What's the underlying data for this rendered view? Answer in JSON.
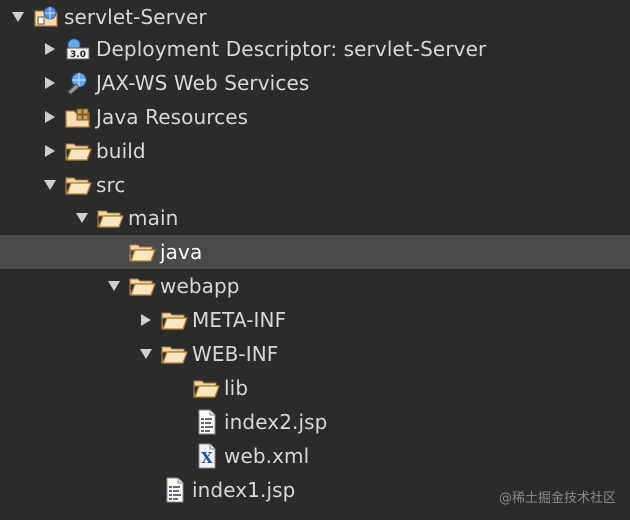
{
  "tree": {
    "project": {
      "label": "servlet-Server"
    },
    "deployment_descriptor": {
      "label": "Deployment Descriptor: servlet-Server",
      "badge": "3.0"
    },
    "jaxws": {
      "label": "JAX-WS Web Services"
    },
    "java_resources": {
      "label": "Java Resources"
    },
    "build": {
      "label": "build"
    },
    "src": {
      "label": "src"
    },
    "main": {
      "label": "main"
    },
    "java": {
      "label": "java"
    },
    "webapp": {
      "label": "webapp"
    },
    "meta_inf": {
      "label": "META-INF"
    },
    "web_inf": {
      "label": "WEB-INF"
    },
    "lib": {
      "label": "lib"
    },
    "index2": {
      "label": "index2.jsp"
    },
    "webxml": {
      "label": "web.xml",
      "badge": "X"
    },
    "index1": {
      "label": "index1.jsp"
    }
  },
  "icons": {
    "expanded": "triangle-down-icon",
    "collapsed": "triangle-right-icon",
    "folder": "folder-open-icon",
    "jsp": "jsp-file-icon",
    "xml": "xml-file-icon"
  },
  "colors": {
    "background": "#2b2b2b",
    "selection": "#4a4a4a",
    "text": "#d8d8d8",
    "folder": "#e8c48a"
  },
  "watermark": "@稀土掘金技术社区"
}
